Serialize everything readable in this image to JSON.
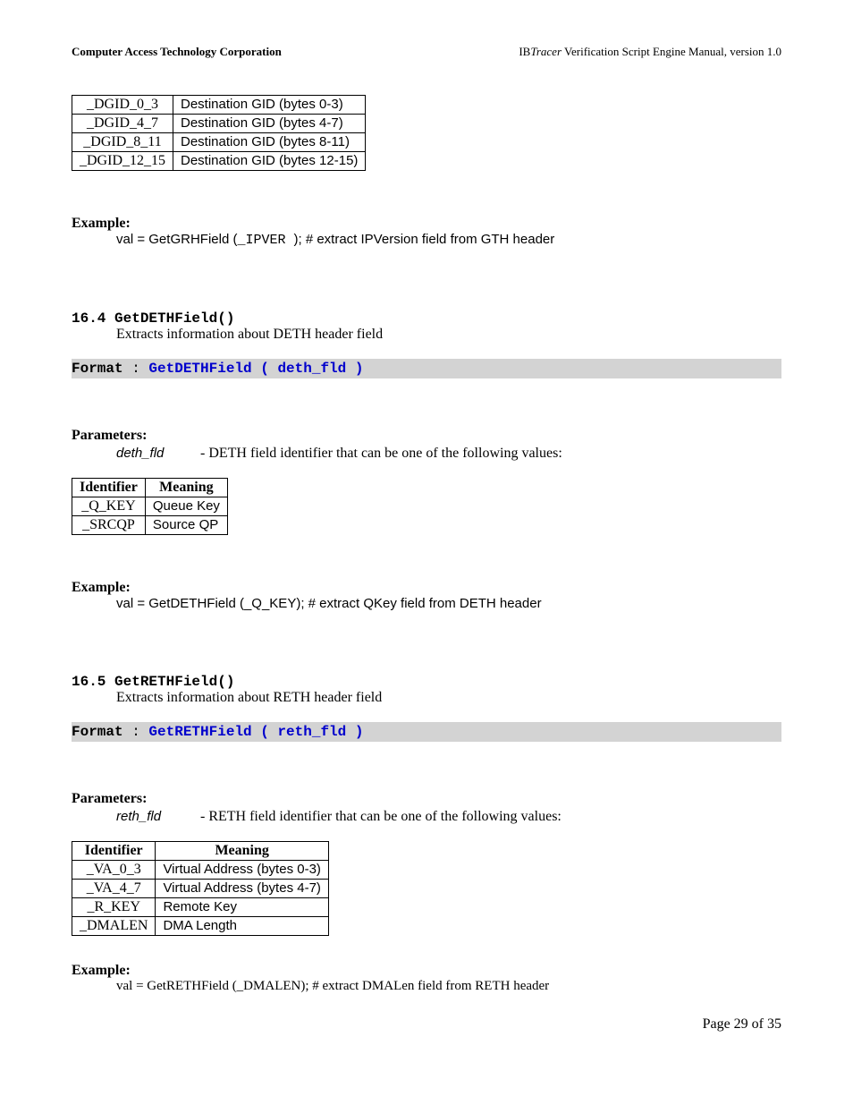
{
  "header": {
    "left": "Computer Access Technology Corporation",
    "right_prefix": "IB",
    "right_italic": "Tracer",
    "right_suffix": " Verification Script Engine Manual, version 1.0"
  },
  "table1": {
    "rows": [
      {
        "id": "_DGID_0_3",
        "meaning": "Destination GID (bytes 0-3)"
      },
      {
        "id": "_DGID_4_7",
        "meaning": "Destination GID (bytes 4-7)"
      },
      {
        "id": "_DGID_8_11",
        "meaning": "Destination GID (bytes 8-11)"
      },
      {
        "id": "_DGID_12_15",
        "meaning": "Destination GID (bytes 12-15)"
      }
    ]
  },
  "example1": {
    "label": "Example:",
    "prefix": "val  = GetGRHField (",
    "mono": "_IPVER ",
    "suffix": "); # extract IPVersion field from GTH header"
  },
  "sec164": {
    "num": "16.4 GetDETHField()",
    "desc": "Extracts information about DETH header field",
    "format_kw": "Format ",
    "format_colon": ": ",
    "format_fn": " GetDETHField ( deth_fld )",
    "params_label": "Parameters:",
    "param_name": "deth_fld",
    "param_desc": "-  DETH field identifier that can be one of the following values:",
    "table_h1": "Identifier",
    "table_h2": "Meaning",
    "rows": [
      {
        "id": "_Q_KEY",
        "meaning": "Queue Key"
      },
      {
        "id": "_SRCQP",
        "meaning": "Source QP"
      }
    ],
    "example_label": "Example:",
    "example_code": "val  = GetDETHField (_Q_KEY); # extract QKey field from DETH header"
  },
  "sec165": {
    "num": "16.5 GetRETHField()",
    "desc": "Extracts information about RETH header field",
    "format_kw": "Format ",
    "format_colon": ": ",
    "format_fn": " GetRETHField ( reth_fld )",
    "params_label": "Parameters:",
    "param_name": "reth_fld",
    "param_desc": "-  RETH field identifier that can be one of the following values:",
    "table_h1": "Identifier",
    "table_h2": "Meaning",
    "rows": [
      {
        "id": "_VA_0_3",
        "meaning": "Virtual Address (bytes 0-3)"
      },
      {
        "id": "_VA_4_7",
        "meaning": "Virtual Address (bytes 4-7)"
      },
      {
        "id": "_R_KEY",
        "meaning": "Remote Key"
      },
      {
        "id": "_DMALEN",
        "meaning": "DMA Length"
      }
    ],
    "example_label": "Example:",
    "example_code": "val  = GetRETHField (_DMALEN); # extract DMALen field from RETH header"
  },
  "footer": "Page 29 of 35"
}
